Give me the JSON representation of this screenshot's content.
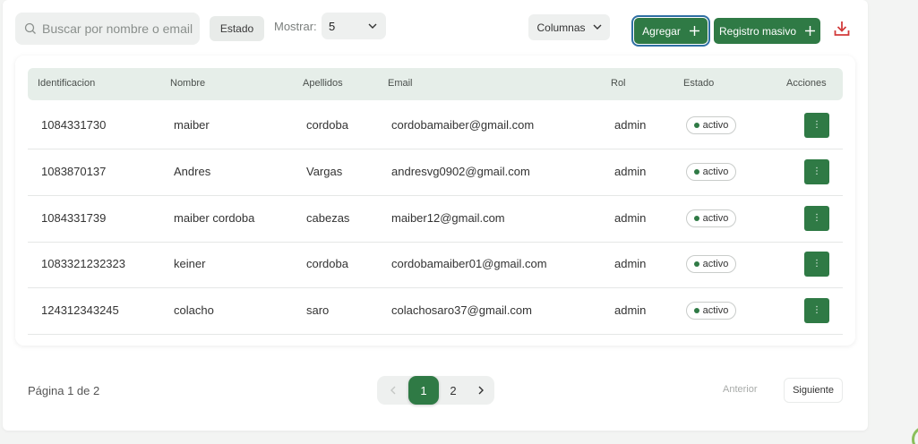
{
  "toolbar": {
    "search_placeholder": "Buscar por nombre o email",
    "estado_label": "Estado",
    "mostrar_label": "Mostrar:",
    "mostrar_value": "5",
    "columnas_label": "Columnas",
    "agregar_label": "Agregar",
    "masivo_label": "Registro masivo"
  },
  "table": {
    "headers": {
      "id": "Identificacion",
      "nombre": "Nombre",
      "apellidos": "Apellidos",
      "email": "Email",
      "rol": "Rol",
      "estado": "Estado",
      "acciones": "Acciones"
    },
    "rows": [
      {
        "id": "1084331730",
        "nombre": "maiber",
        "apellidos": "cordoba",
        "email": "cordobamaiber@gmail.com",
        "rol": "admin",
        "estado": "activo"
      },
      {
        "id": "1083870137",
        "nombre": "Andres",
        "apellidos": "Vargas",
        "email": "andresvg0902@gmail.com",
        "rol": "admin",
        "estado": "activo"
      },
      {
        "id": "1084331739",
        "nombre": "maiber cordoba",
        "apellidos": "cabezas",
        "email": "maiber12@gmail.com",
        "rol": "admin",
        "estado": "activo"
      },
      {
        "id": "1083321232323",
        "nombre": "keiner",
        "apellidos": "cordoba",
        "email": "cordobamaiber01@gmail.com",
        "rol": "admin",
        "estado": "activo"
      },
      {
        "id": "124312343245",
        "nombre": "colacho",
        "apellidos": "saro",
        "email": "colachosaro37@gmail.com",
        "rol": "admin",
        "estado": "activo"
      }
    ],
    "action_icon": "⋮"
  },
  "pagination": {
    "info": "Página 1 de 2",
    "page1": "1",
    "page2": "2",
    "prev_label": "Anterior",
    "next_label": "Siguiente"
  },
  "colors": {
    "accent": "#2f7a45",
    "download_icon": "#d23a3a"
  }
}
